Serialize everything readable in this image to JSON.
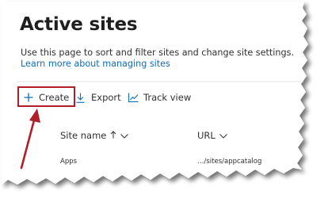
{
  "page": {
    "title": "Active sites",
    "description": "Use this page to sort and filter sites and change site settings.",
    "learn_link": "Learn more about managing sites"
  },
  "toolbar": {
    "create_label": "Create",
    "export_label": "Export",
    "track_label": "Track view",
    "create_icon": "plus-icon",
    "export_icon": "download-icon",
    "track_icon": "line-chart-icon"
  },
  "table": {
    "columns": [
      {
        "label": "Site name",
        "sort_icon": "arrow-up-icon",
        "menu_icon": "chevron-down-icon"
      },
      {
        "label": "URL",
        "menu_icon": "chevron-down-icon"
      }
    ],
    "rows": [
      {
        "site_name": "Apps",
        "url": "…/sites/appcatalog"
      }
    ]
  },
  "colors": {
    "accent": "#0f6cbd",
    "highlight": "#b01e2a",
    "text": "#323130"
  }
}
